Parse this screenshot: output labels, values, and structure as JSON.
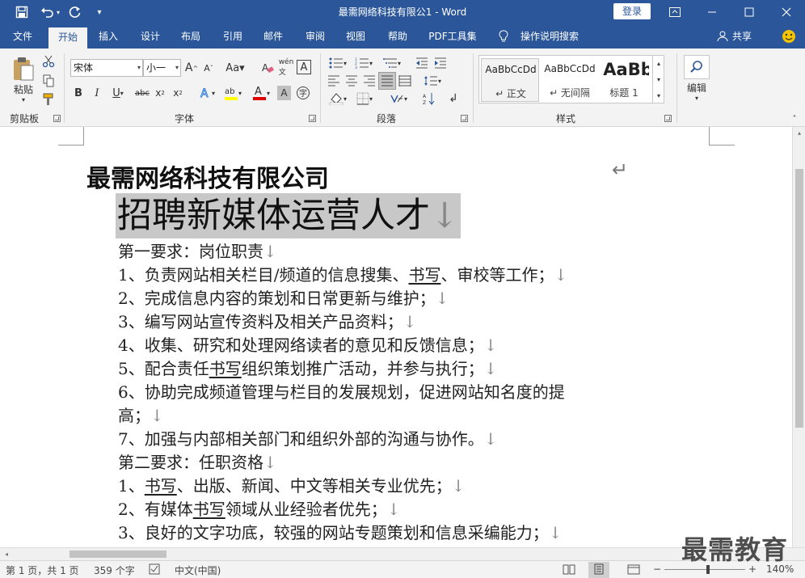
{
  "app": {
    "window_title": "最需网络科技有限公1  -  Word",
    "login_label": "登录"
  },
  "tabs": [
    {
      "label": "文件"
    },
    {
      "label": "开始"
    },
    {
      "label": "插入"
    },
    {
      "label": "设计"
    },
    {
      "label": "布局"
    },
    {
      "label": "引用"
    },
    {
      "label": "邮件"
    },
    {
      "label": "审阅"
    },
    {
      "label": "视图"
    },
    {
      "label": "帮助"
    },
    {
      "label": "PDF工具集"
    },
    {
      "label": "操作说明搜索"
    }
  ],
  "share_label": "共享",
  "ribbon": {
    "clipboard": {
      "paste_label": "粘贴",
      "group_label": "剪贴板"
    },
    "font": {
      "font_name": "宋体",
      "font_size": "小一",
      "group_label": "字体"
    },
    "paragraph": {
      "group_label": "段落"
    },
    "styles": {
      "group_label": "样式",
      "items": [
        {
          "preview": "AaBbCcDd",
          "name": "↵ 正文"
        },
        {
          "preview": "AaBbCcDd",
          "name": "↵ 无间隔"
        },
        {
          "preview": "AaBb",
          "name": "标题 1"
        }
      ]
    },
    "editing": {
      "label": "编辑"
    }
  },
  "document": {
    "company": "最需网络科技有限公司",
    "headline": "招聘新媒体运营人才",
    "lines": [
      [
        "第一要求：岗位职责",
        "",
        "",
        "↓"
      ],
      [
        "1、负责网站相关栏目/频道的信息搜集、",
        "书写",
        "、审校等工作；",
        "↓"
      ],
      [
        "2、完成信息内容的策划和日常更新与维护；",
        "",
        "",
        "↓"
      ],
      [
        "3、编写网站宣传资料及相关产品资料；",
        "",
        "",
        "↓"
      ],
      [
        "4、收集、研究和处理网络读者的意见和反馈信息；",
        "",
        "",
        "↓"
      ],
      [
        "5、配合责任",
        "书写",
        "组织策划推广活动，并参与执行；",
        "↓"
      ],
      [
        "6、协助完成频道管理与栏目的发展规划，促进网站知名度的提",
        "",
        "",
        ""
      ],
      [
        "高；",
        "",
        "",
        "↓"
      ],
      [
        "7、加强与内部相关部门和组织外部的沟通与协作。",
        "",
        "",
        "↓"
      ],
      [
        "第二要求：任职资格",
        "",
        "",
        "↓"
      ],
      [
        "1、",
        "书写",
        "、出版、新闻、中文等相关专业优先；",
        "↓"
      ],
      [
        "2、有媒体",
        "书写",
        "领域从业经验者优先；",
        "↓"
      ],
      [
        "3、良好的文字功底，较强的网站专题策划和信息采编能力；",
        "",
        "",
        "↓"
      ]
    ]
  },
  "status": {
    "page": "第 1 页，共 1 页",
    "words": "359 个字",
    "language": "中文(中国)",
    "zoom": "140%"
  },
  "watermark": "最需教育",
  "colors": {
    "accent": "#2b579a",
    "selection": "#c8c8c8",
    "font_color_bar": "#e00000",
    "highlight_bar": "#ffff00"
  }
}
